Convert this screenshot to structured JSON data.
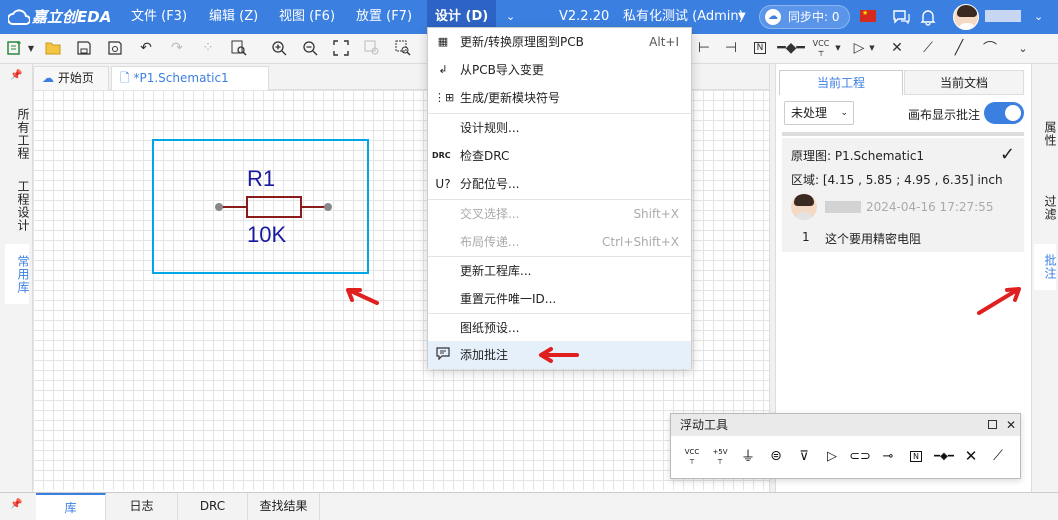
{
  "app": {
    "logo_text": "嘉立创EDA",
    "version": "V2.2.20",
    "workspace": "私有化测试 (Admin)",
    "sync_label": "同步中: 0"
  },
  "menu": {
    "file": "文件 (F3)",
    "edit": "编辑 (Z)",
    "view": "视图 (F6)",
    "place": "放置 (F7)",
    "design": "设计 (D)"
  },
  "tabs": {
    "home": "开始页",
    "schematic": "*P1.Schematic1"
  },
  "left_tabs": {
    "all_projects": "所有工程",
    "project_design": "工程设计",
    "common_lib": "常用库"
  },
  "schematic": {
    "designator": "R1",
    "value": "10K"
  },
  "design_menu": {
    "items": [
      {
        "label": "更新/转换原理图到PCB",
        "shortcut": "Alt+I",
        "icon": "pcb-convert-icon"
      },
      {
        "label": "从PCB导入变更",
        "shortcut": "",
        "icon": "import-icon"
      },
      {
        "label": "生成/更新模块符号",
        "shortcut": "",
        "icon": "module-symbol-icon"
      },
      {
        "label": "设计规则...",
        "shortcut": "",
        "icon": ""
      },
      {
        "label": "检查DRC",
        "shortcut": "",
        "icon": "DRC"
      },
      {
        "label": "分配位号...",
        "shortcut": "",
        "icon": "U?"
      },
      {
        "label": "交叉选择...",
        "shortcut": "Shift+X",
        "icon": ""
      },
      {
        "label": "布局传递...",
        "shortcut": "Ctrl+Shift+X",
        "icon": ""
      },
      {
        "label": "更新工程库...",
        "shortcut": "",
        "icon": ""
      },
      {
        "label": "重置元件唯一ID...",
        "shortcut": "",
        "icon": ""
      },
      {
        "label": "图纸预设...",
        "shortcut": "",
        "icon": ""
      },
      {
        "label": "添加批注",
        "shortcut": "",
        "icon": "comment-icon"
      }
    ]
  },
  "right_panel": {
    "tab_current_project": "当前工程",
    "tab_current_doc": "当前文档",
    "filter_value": "未处理",
    "show_comments_label": "画布显示批注",
    "show_comments_on": true,
    "comment": {
      "doc": "原理图: P1.Schematic1",
      "area": "区域: [4.15 , 5.85 ; 4.95 , 6.35] inch",
      "time": "2024-04-16 17:27:55",
      "index": "1",
      "text": "这个要用精密电阻"
    }
  },
  "right_tabs": {
    "properties": "属性",
    "filter": "过滤",
    "comments": "批注"
  },
  "float_tools": {
    "title": "浮动工具",
    "items": [
      "vcc-icon",
      "plus5v-icon",
      "ground-icon",
      "earth-icon",
      "ground-arrow-icon",
      "net-port-icon",
      "net-label-icon",
      "net-flag-icon",
      "netlabel-box-icon",
      "bus-entry-icon",
      "no-connect-icon",
      "wire-icon"
    ],
    "vcc": "VCC",
    "plus5v": "+5V",
    "net_box": "N"
  },
  "bottom_tabs": {
    "library": "库",
    "log": "日志",
    "drc": "DRC",
    "find": "查找结果"
  },
  "toolbar_text": {
    "vcc": "VCC",
    "n": "N"
  },
  "colors": {
    "accent": "#3b7fe0",
    "menubar": "#3b7fe0",
    "schematic_box": "#00a6e6",
    "resistor": "#8b1a1a",
    "designator": "#1a1aa0",
    "arrow": "#e02020"
  }
}
